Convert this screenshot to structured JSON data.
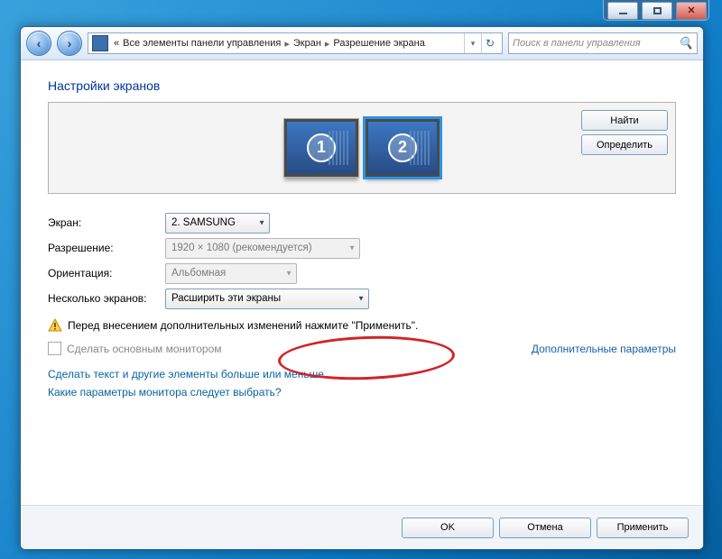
{
  "breadcrumbs": {
    "root_prefix": "«",
    "item1": "Все элементы панели управления",
    "item2": "Экран",
    "item3": "Разрешение экрана"
  },
  "search": {
    "placeholder": "Поиск в панели управления"
  },
  "page_title": "Настройки экранов",
  "side_buttons": {
    "find": "Найти",
    "identify": "Определить"
  },
  "monitors": {
    "one": "1",
    "two": "2"
  },
  "labels": {
    "display": "Экран:",
    "resolution": "Разрешение:",
    "orientation": "Ориентация:",
    "multi": "Несколько экранов:"
  },
  "values": {
    "display": "2. SAMSUNG",
    "resolution": "1920 × 1080 (рекомендуется)",
    "orientation": "Альбомная",
    "multi": "Расширить эти экраны"
  },
  "warning_text": "Перед внесением дополнительных изменений нажмите \"Применить\".",
  "checkbox_label": "Сделать основным монитором",
  "advanced_link": "Дополнительные параметры",
  "link1": "Сделать текст и другие элементы больше или меньше",
  "link2": "Какие параметры монитора следует выбрать?",
  "footer": {
    "ok": "OK",
    "cancel": "Отмена",
    "apply": "Применить"
  }
}
